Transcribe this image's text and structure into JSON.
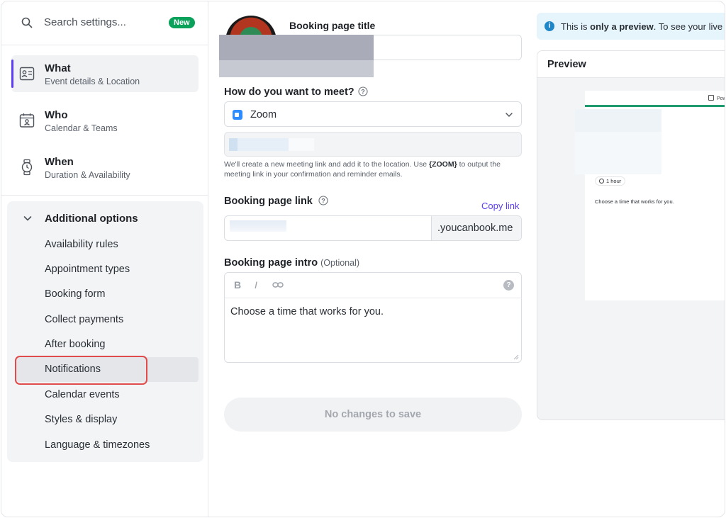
{
  "search": {
    "placeholder": "Search settings...",
    "badge": "New"
  },
  "nav": {
    "items": [
      {
        "title": "What",
        "subtitle": "Event details & Location",
        "icon": "id-card-icon",
        "active": true
      },
      {
        "title": "Who",
        "subtitle": "Calendar & Teams",
        "icon": "calendar-user-icon",
        "active": false
      },
      {
        "title": "When",
        "subtitle": "Duration & Availability",
        "icon": "watch-icon",
        "active": false
      }
    ]
  },
  "additional": {
    "title": "Additional options",
    "items": [
      "Availability rules",
      "Appointment types",
      "Booking form",
      "Collect payments",
      "After booking",
      "Notifications",
      "Calendar events",
      "Styles & display",
      "Language & timezones"
    ],
    "highlighted": "Notifications"
  },
  "form": {
    "title_label": "Booking page title",
    "meet_label": "How do you want to meet?",
    "meet_value": "Zoom",
    "meet_hint_pre": "We'll create a new meeting link and add it to the location. Use ",
    "meet_hint_token": "{ZOOM}",
    "meet_hint_post": " to output the meeting link in your confirmation and reminder emails.",
    "link_label": "Booking page link",
    "copy_link": "Copy link",
    "link_suffix": ".youcanbook.me",
    "intro_label": "Booking page intro",
    "intro_optional": "(Optional)",
    "intro_text": "Choose a time that works for you.",
    "toolbar": {
      "bold": "B",
      "italic": "I",
      "link": "⧉",
      "help": "?"
    },
    "save_label": "No changes to save"
  },
  "preview": {
    "banner_pre": "This is ",
    "banner_bold": "only a preview",
    "banner_post": ". To see your live a",
    "title": "Preview",
    "powered": "Powe",
    "duration": "1 hour",
    "intro": "Choose a time that works for you."
  },
  "colors": {
    "accent": "#5b3df5",
    "badge": "#0aa25a",
    "highlight_box": "#e04b4b",
    "zoom": "#2d8cff",
    "mini_bar": "#1f9a6f"
  }
}
